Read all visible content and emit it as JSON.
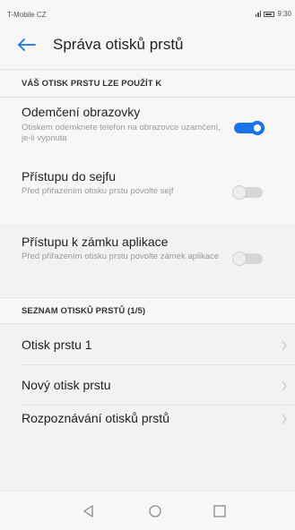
{
  "status_bar": {
    "carrier": "T-Mobile CZ",
    "time": "9:30"
  },
  "app_bar": {
    "title": "Správa otisků prstů",
    "back_icon": "arrow-back-icon",
    "accent": "#1a73e8"
  },
  "section1": {
    "header": "VÁŠ OTISK PRSTU LZE POUŽÍT K",
    "items": [
      {
        "label": "Odemčení obrazovky",
        "sub": "Otiskem odemknete telefon na obrazovce uzamčení, je-li vypnuta",
        "toggle": true
      },
      {
        "label": "Přístupu do sejfu",
        "sub": "Před přiřazením otisku prstu povolte sejf",
        "toggle": false
      },
      {
        "label": "Přístupu k zámku aplikace",
        "sub": "Před přiřazením otisku prstu povolte zámek aplikace",
        "toggle": false
      }
    ]
  },
  "section2": {
    "header": "SEZNAM OTISKŮ PRSTŮ (1/5)",
    "items": [
      {
        "label": "Otisk prstu 1"
      },
      {
        "label": "Nový otisk prstu"
      },
      {
        "label": "Rozpoznávání otisků prstů"
      }
    ]
  },
  "nav_bar": {
    "icons": [
      "back-triangle-icon",
      "home-circle-icon",
      "recents-square-icon"
    ]
  }
}
